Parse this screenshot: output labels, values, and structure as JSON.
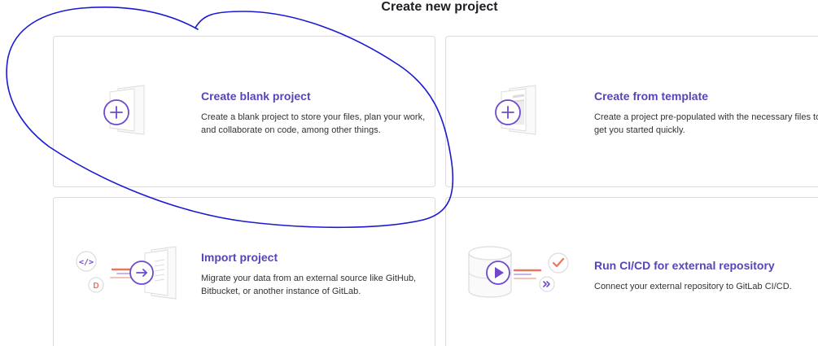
{
  "page": {
    "title": "Create new project"
  },
  "colors": {
    "accent": "#6e49cb",
    "title_text": "#5943b6",
    "border": "#dcdcde",
    "orange": "#e9765f",
    "annotation_ink": "#1a1ad4"
  },
  "cards": [
    {
      "title": "Create blank project",
      "description": "Create a blank project to store your files, plan your work, and collaborate on code, among other things.",
      "icon": "blank-project-icon"
    },
    {
      "title": "Create from template",
      "description": "Create a project pre-populated with the necessary files to get you started quickly.",
      "icon": "template-project-icon"
    },
    {
      "title": "Import project",
      "description": "Migrate your data from an external source like GitHub, Bitbucket, or another instance of GitLab.",
      "icon": "import-project-icon",
      "illustration_badge": "D"
    },
    {
      "title": "Run CI/CD for external repository",
      "description": "Connect your external repository to GitLab CI/CD.",
      "icon": "cicd-external-repo-icon"
    }
  ]
}
